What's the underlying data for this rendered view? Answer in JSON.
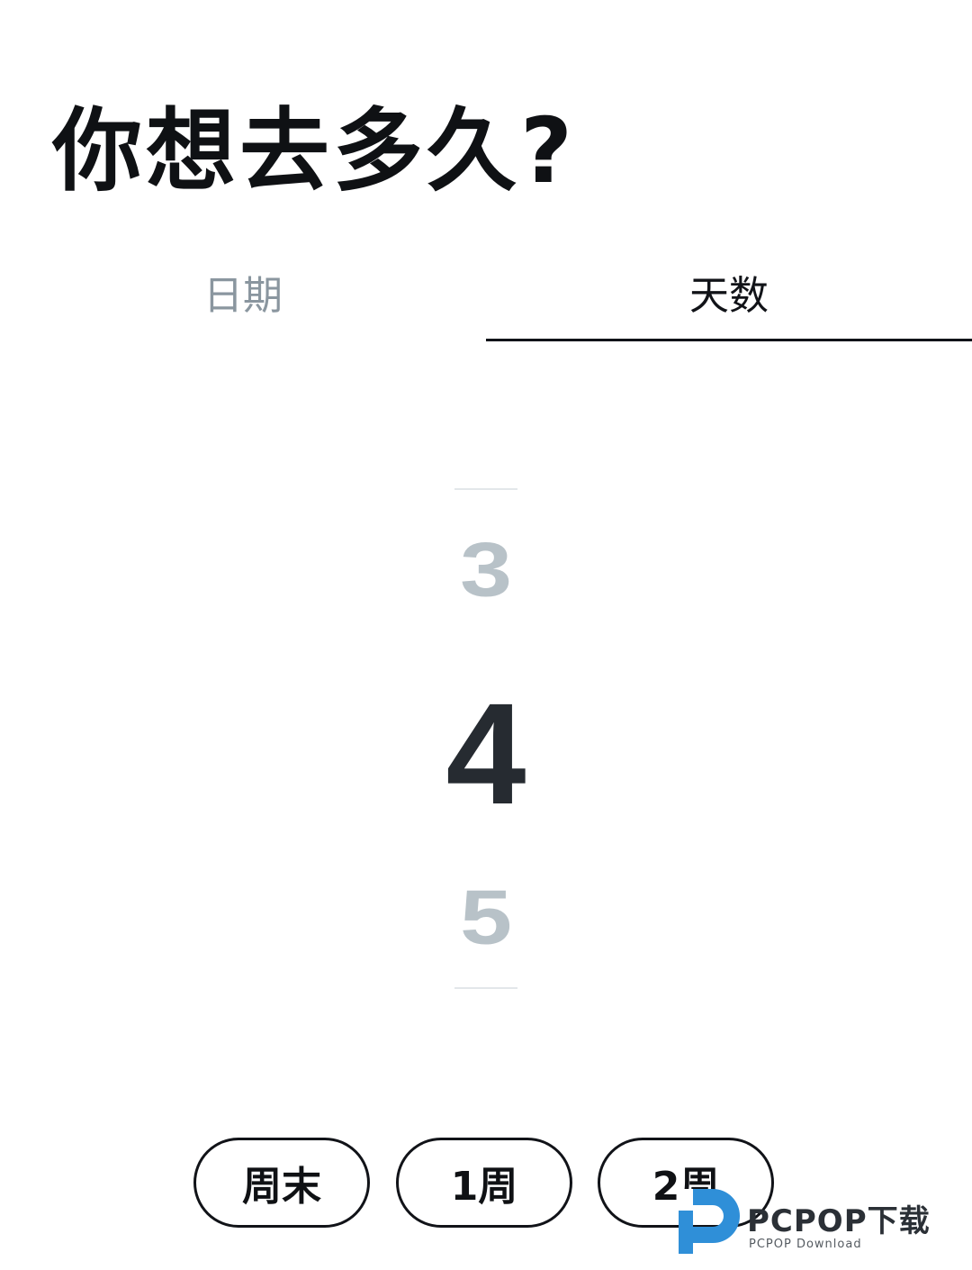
{
  "header": {
    "title": "你想去多久?"
  },
  "tabs": [
    {
      "label": "日期",
      "selected": false
    },
    {
      "label": "天数",
      "selected": true
    }
  ],
  "picker": {
    "previous": "3",
    "current": "4",
    "next": "5"
  },
  "quick_options": [
    {
      "label": "周末"
    },
    {
      "label": "1周"
    },
    {
      "label": "2周"
    }
  ],
  "watermark": {
    "brand": "PCPOP下载",
    "subtitle": "PCPOP Download"
  },
  "colors": {
    "text_primary": "#111318",
    "tab_inactive": "#8a969f",
    "picker_faded": "#b8c2c8",
    "watermark_blue": "#2f8fd8"
  }
}
